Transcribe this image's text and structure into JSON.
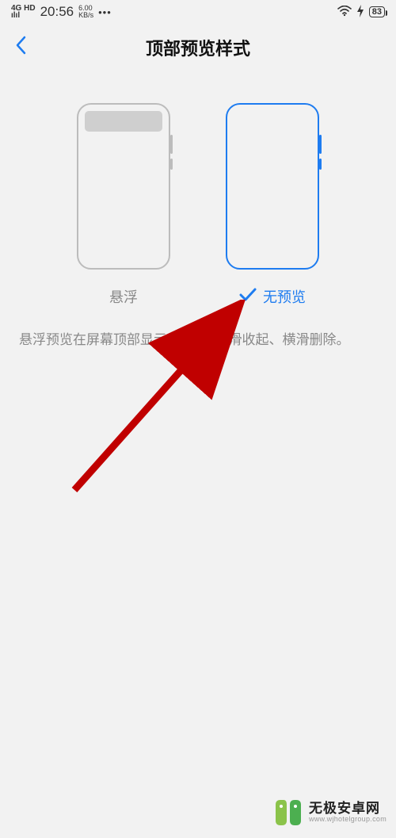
{
  "statusBar": {
    "networkTop": "4G HD",
    "networkBottom": "ılıl",
    "time": "20:56",
    "speedTop": "6.00",
    "speedBottom": "KB/s",
    "dots": "•••",
    "wifi": "≈",
    "bolt": "⚡",
    "battery": "83"
  },
  "header": {
    "back": "<",
    "title": "顶部预览样式"
  },
  "options": {
    "float": {
      "label": "悬浮",
      "selected": false
    },
    "none": {
      "label": "无预览",
      "selected": true
    }
  },
  "description": "悬浮预览在屏幕顶部显示5秒，可上滑收起、横滑删除。",
  "check": "✓",
  "watermark": {
    "line1": "无极安卓网",
    "line2": "www.wjhotelgroup.com"
  }
}
